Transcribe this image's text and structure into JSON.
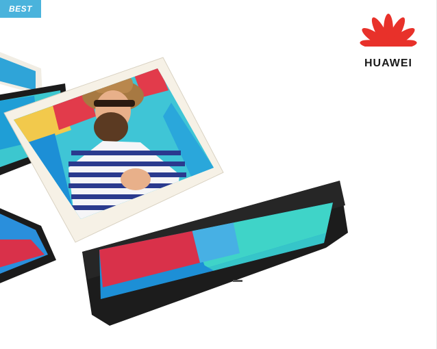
{
  "badge": {
    "label": "BEST",
    "color": "#4ab3dc"
  },
  "brand": {
    "name": "HUAWEI",
    "logo_icon": "huawei-petal-logo",
    "logo_color": "#e8312a"
  },
  "product_image": {
    "subject": "tablet-product-photo",
    "tablet_colors": [
      "#f3efe6",
      "#1c1c1c"
    ]
  }
}
